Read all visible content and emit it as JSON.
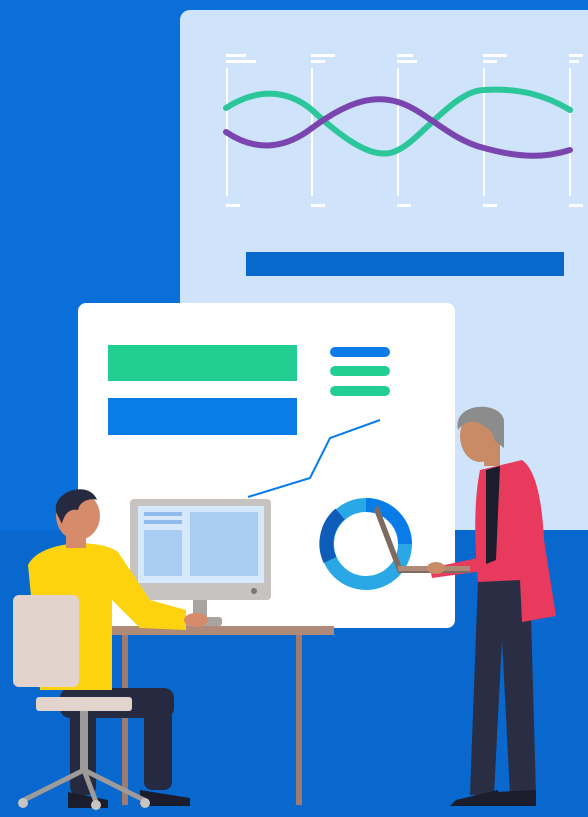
{
  "palette": {
    "background": "#0A6FD8",
    "back_panel": "#CFE4FB",
    "front_panel": "#FFFFFF",
    "accent_green": "#22CE92",
    "accent_blue": "#0A7CE8",
    "dark_blue_bar": "#0769CB",
    "wave_green": "#2BC79A",
    "wave_purple": "#7B45B0",
    "jacket_red": "#E83A5C",
    "shirt_yellow": "#FDD20F",
    "trousers_navy": "#2A2E45",
    "desk_tan": "#B08A78",
    "chair_beige": "#E2D4CC"
  },
  "illustration": {
    "back_panel_content": "wave-line-chart",
    "front_panel_content": [
      "green-bar",
      "blue-bar",
      "legend-pills",
      "trend-line",
      "donut-ring"
    ],
    "figures": [
      "seated-man-at-computer",
      "standing-man-with-laptop"
    ]
  },
  "icons": {
    "donut": "donut-chart-icon",
    "monitor": "computer-monitor-icon",
    "laptop": "laptop-icon",
    "chair": "office-chair-icon"
  }
}
